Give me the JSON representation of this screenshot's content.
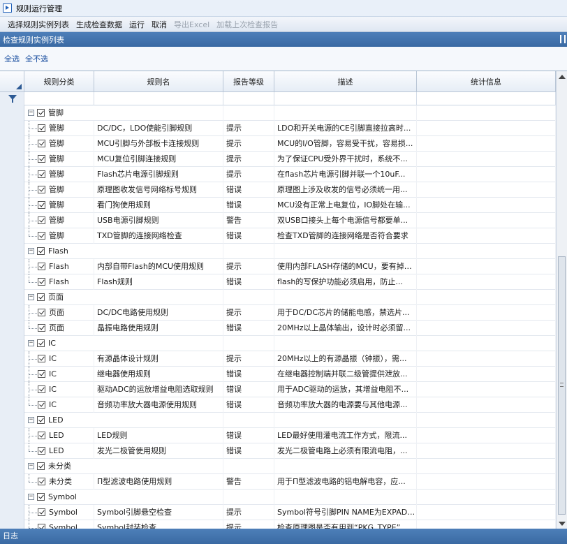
{
  "window": {
    "title": "规则运行管理"
  },
  "menu": [
    {
      "label": "选择规则实例列表",
      "enabled": true
    },
    {
      "label": "生成检查数据",
      "enabled": true
    },
    {
      "label": "运行",
      "enabled": true
    },
    {
      "label": "取消",
      "enabled": true
    },
    {
      "label": "导出Excel",
      "enabled": false
    },
    {
      "label": "加载上次检查报告",
      "enabled": false
    }
  ],
  "panel": {
    "title": "检查规则实例列表"
  },
  "selection": {
    "select_all": "全选",
    "select_none": "全不选"
  },
  "grid": {
    "columns": [
      "规则分类",
      "规则名",
      "报告等级",
      "描述",
      "统计信息"
    ],
    "groups": [
      {
        "name": "管脚",
        "rows": [
          {
            "category": "管脚",
            "name": "DC/DC，LDO使能引脚规则",
            "level": "提示",
            "description": "LDO和开关电源的CE引脚直接拉高时..."
          },
          {
            "category": "管脚",
            "name": "MCU引脚与外部板卡连接规则",
            "level": "提示",
            "description": "MCU的I/O管脚，容易受干扰，容易损..."
          },
          {
            "category": "管脚",
            "name": "MCU复位引脚连接规则",
            "level": "提示",
            "description": "为了保证CPU受外界干扰时，系统不..."
          },
          {
            "category": "管脚",
            "name": "Flash芯片电源引脚规则",
            "level": "提示",
            "description": "在flash芯片电源引脚并联一个10uF..."
          },
          {
            "category": "管脚",
            "name": "原理图收发信号网络标号规则",
            "level": "错误",
            "description": "原理图上涉及收发的信号必须统一用..."
          },
          {
            "category": "管脚",
            "name": "看门狗使用规则",
            "level": "错误",
            "description": "MCU没有正常上电复位，IO脚处在输..."
          },
          {
            "category": "管脚",
            "name": "USB电源引脚规则",
            "level": "警告",
            "description": "双USB口接头上每个电源信号都要单..."
          },
          {
            "category": "管脚",
            "name": "TXD管脚的连接网络检查",
            "level": "错误",
            "description": "检查TXD管脚的连接网络是否符合要求"
          }
        ]
      },
      {
        "name": "Flash",
        "rows": [
          {
            "category": "Flash",
            "name": "内部自带Flash的MCU使用规则",
            "level": "提示",
            "description": "使用内部FLASH存储的MCU，要有掉电..."
          },
          {
            "category": "Flash",
            "name": "Flash规则",
            "level": "错误",
            "description": " flash的写保护功能必须启用，防止..."
          }
        ]
      },
      {
        "name": "页面",
        "rows": [
          {
            "category": "页面",
            "name": "DC/DC电路使用规则",
            "level": "提示",
            "description": "用于DC/DC芯片的储能电感，禁选片..."
          },
          {
            "category": "页面",
            "name": "晶振电路使用规则",
            "level": "错误",
            "description": "20MHz以上晶体输出，设计时必须留..."
          }
        ]
      },
      {
        "name": "IC",
        "rows": [
          {
            "category": "IC",
            "name": "有源晶体设计规则",
            "level": "提示",
            "description": "20MHz以上的有源晶振（钟振），需..."
          },
          {
            "category": "IC",
            "name": "继电器使用规则",
            "level": "错误",
            "description": "在继电器控制端并联二级管提供泄放..."
          },
          {
            "category": "IC",
            "name": "驱动ADC的运放增益电阻选取规则",
            "level": "错误",
            "description": "用于ADC驱动的运放，其增益电阻不..."
          },
          {
            "category": "IC",
            "name": "音频功率放大器电源使用规则",
            "level": "错误",
            "description": "音频功率放大器的电源要与其他电源..."
          }
        ]
      },
      {
        "name": "LED",
        "rows": [
          {
            "category": "LED",
            "name": "LED规则",
            "level": "错误",
            "description": "LED最好使用灌电流工作方式，限流..."
          },
          {
            "category": "LED",
            "name": "发光二极管使用规则",
            "level": "错误",
            "description": "发光二极管电路上必须有限流电阻，..."
          }
        ]
      },
      {
        "name": "未分类",
        "rows": [
          {
            "category": "未分类",
            "name": "Π型滤波电路使用规则",
            "level": "警告",
            "description": "用于Π型滤波电路的铝电解电容，应..."
          }
        ]
      },
      {
        "name": "Symbol",
        "rows": [
          {
            "category": "Symbol",
            "name": "Symbol引脚悬空检查",
            "level": "提示",
            "description": "Symbol符号引脚PIN NAME为EXPAD或P..."
          },
          {
            "category": "Symbol",
            "name": "Symbol封装检查",
            "level": "提示",
            "description": "检查原理图是否有用到“PKG_TYPE”..."
          }
        ]
      }
    ]
  },
  "status": {
    "label": "日志"
  },
  "icons": {
    "app": "run-icon",
    "filter": "funnel-icon",
    "pin": "pin-icon"
  },
  "colors": {
    "header_blue": "#3a6aa3",
    "link_blue": "#1b4fa0",
    "disabled_gray": "#9aa3ae"
  }
}
